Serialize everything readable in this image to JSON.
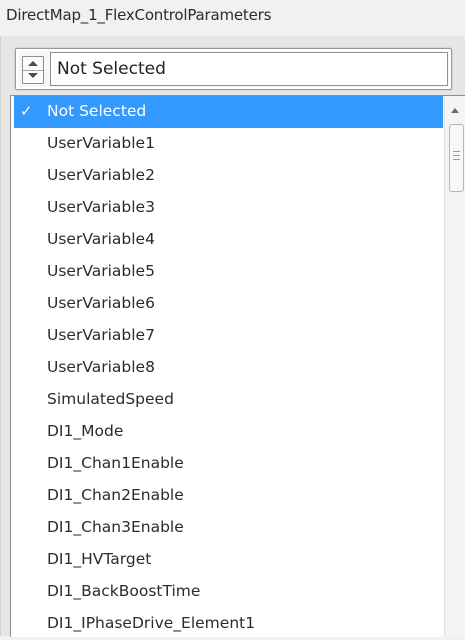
{
  "window": {
    "title": "DirectMap_1_FlexControlParameters"
  },
  "combo": {
    "value": "Not Selected"
  },
  "dropdown": {
    "check_mark": "✓",
    "items": [
      {
        "label": "Not Selected",
        "selected": true
      },
      {
        "label": "UserVariable1"
      },
      {
        "label": "UserVariable2"
      },
      {
        "label": "UserVariable3"
      },
      {
        "label": "UserVariable4"
      },
      {
        "label": "UserVariable5"
      },
      {
        "label": "UserVariable6"
      },
      {
        "label": "UserVariable7"
      },
      {
        "label": "UserVariable8"
      },
      {
        "label": "SimulatedSpeed"
      },
      {
        "label": "DI1_Mode"
      },
      {
        "label": "DI1_Chan1Enable"
      },
      {
        "label": "DI1_Chan2Enable"
      },
      {
        "label": "DI1_Chan3Enable"
      },
      {
        "label": "DI1_HVTarget"
      },
      {
        "label": "DI1_BackBoostTime"
      },
      {
        "label": "DI1_IPhaseDrive_Element1"
      }
    ]
  },
  "colors": {
    "selection": "#3399ff",
    "background": "#f1f1f0"
  }
}
